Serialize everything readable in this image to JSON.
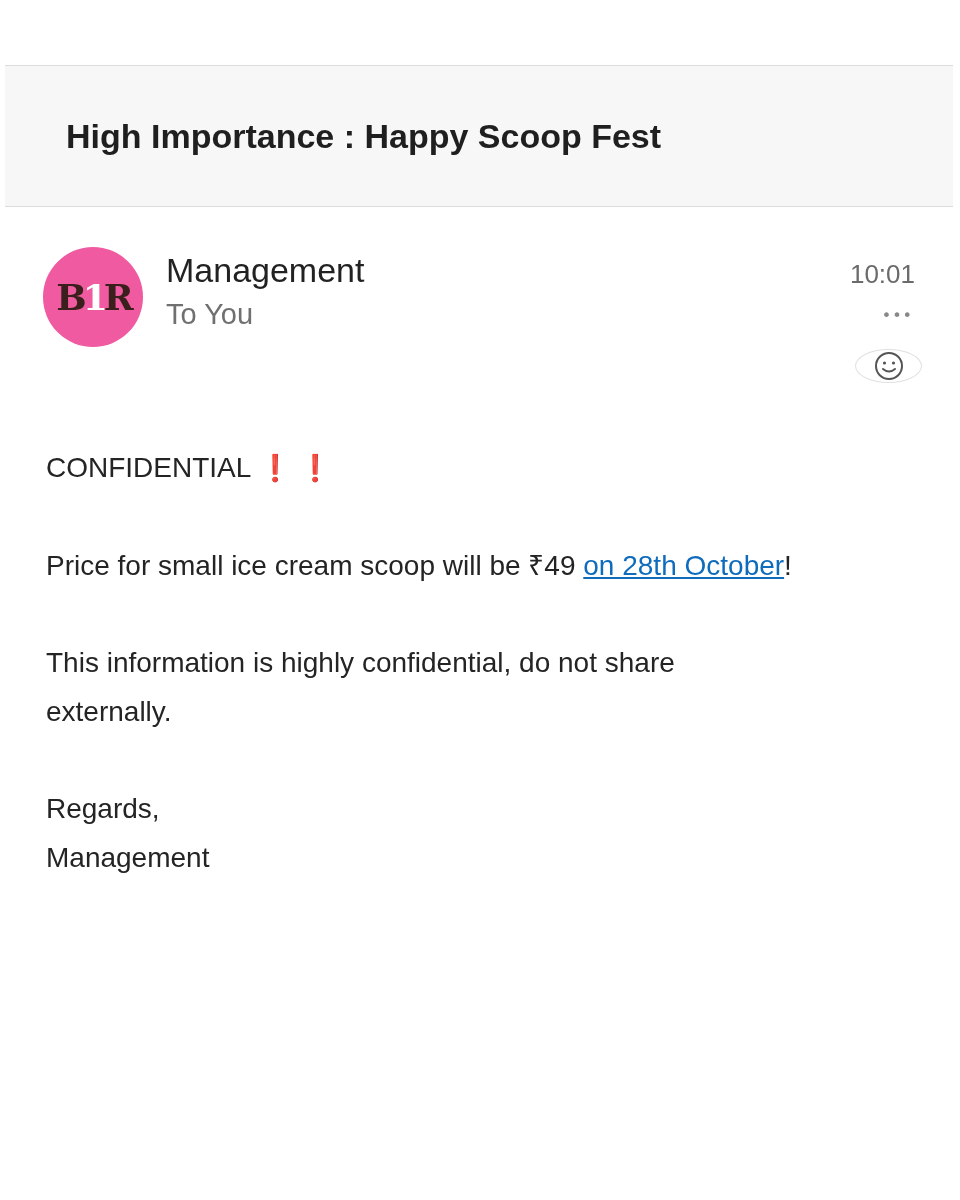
{
  "header": {
    "title": "High Importance : Happy Scoop Fest"
  },
  "message": {
    "avatar_logo": "B1R",
    "sender": "Management",
    "recipient": "To You",
    "time": "10:01",
    "more": "•••"
  },
  "body": {
    "heading": "CONFIDENTIAL",
    "heading_marks": [
      "❗",
      "❗"
    ],
    "price_line": "Price for small ice cream scoop will be ₹49 ",
    "price_link": "on 28th October",
    "price_end": "!",
    "notice": "This information is highly confidential, do not share externally.",
    "closing": "Regards,",
    "signature": "Management"
  }
}
